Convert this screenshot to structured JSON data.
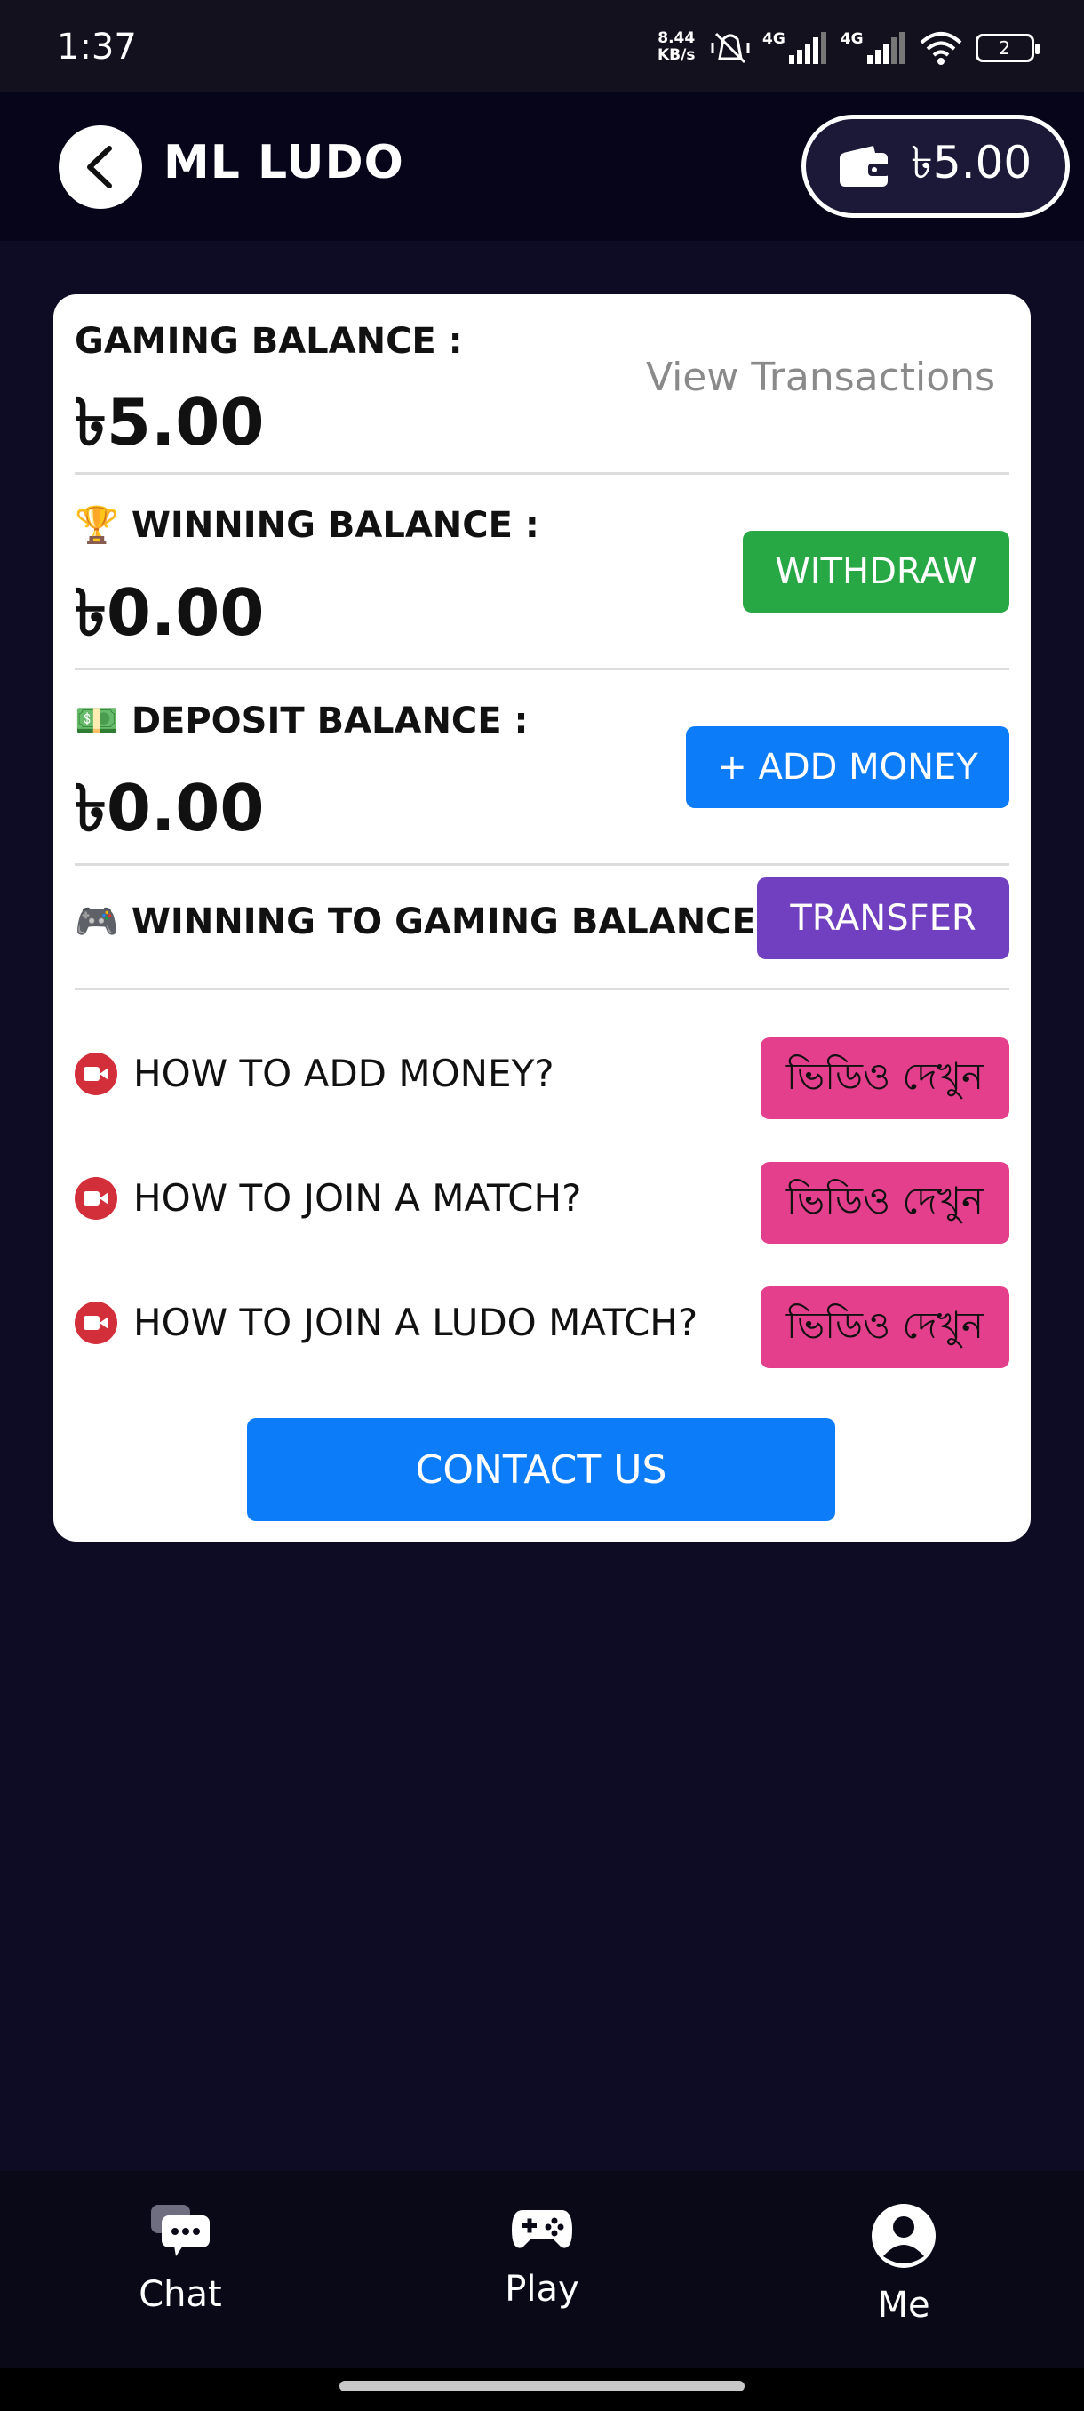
{
  "status_bar": {
    "time": "1:37",
    "speed_value": "8.44",
    "speed_unit": "KB/s",
    "network_1": "4G",
    "network_2": "4G",
    "battery": "2"
  },
  "header": {
    "title": "ML LUDO",
    "wallet_amount": "৳5.00"
  },
  "card": {
    "gaming_balance": {
      "label": "GAMING BALANCE :",
      "value": "৳5.00",
      "link": "View Transactions"
    },
    "winning_balance": {
      "icon": "🏆",
      "label": "WINNING BALANCE :",
      "value": "৳0.00",
      "button": "WITHDRAW"
    },
    "deposit_balance": {
      "icon": "💵",
      "label": "DEPOSIT BALANCE :",
      "value": "৳0.00",
      "button": "+ ADD MONEY"
    },
    "transfer": {
      "icon": "🎮",
      "label": "WINNING TO GAMING BALANCE",
      "button": "TRANSFER"
    },
    "help": [
      {
        "label": "HOW TO ADD MONEY?",
        "button": "ভিডিও দেখুন"
      },
      {
        "label": "HOW TO JOIN A MATCH?",
        "button": "ভিডিও দেখুন"
      },
      {
        "label": "HOW TO JOIN A LUDO MATCH?",
        "button": "ভিডিও দেখুন"
      }
    ],
    "contact_button": "CONTACT US"
  },
  "bottom_nav": [
    {
      "label": "Chat",
      "icon": "chat-icon"
    },
    {
      "label": "Play",
      "icon": "gamepad-icon"
    },
    {
      "label": "Me",
      "icon": "user-icon"
    }
  ],
  "colors": {
    "background": "#0e0c24",
    "withdraw": "#27a844",
    "add_money": "#0d7cf8",
    "transfer": "#7040c0",
    "video": "#e33f8c",
    "contact": "#0d7cf8"
  }
}
